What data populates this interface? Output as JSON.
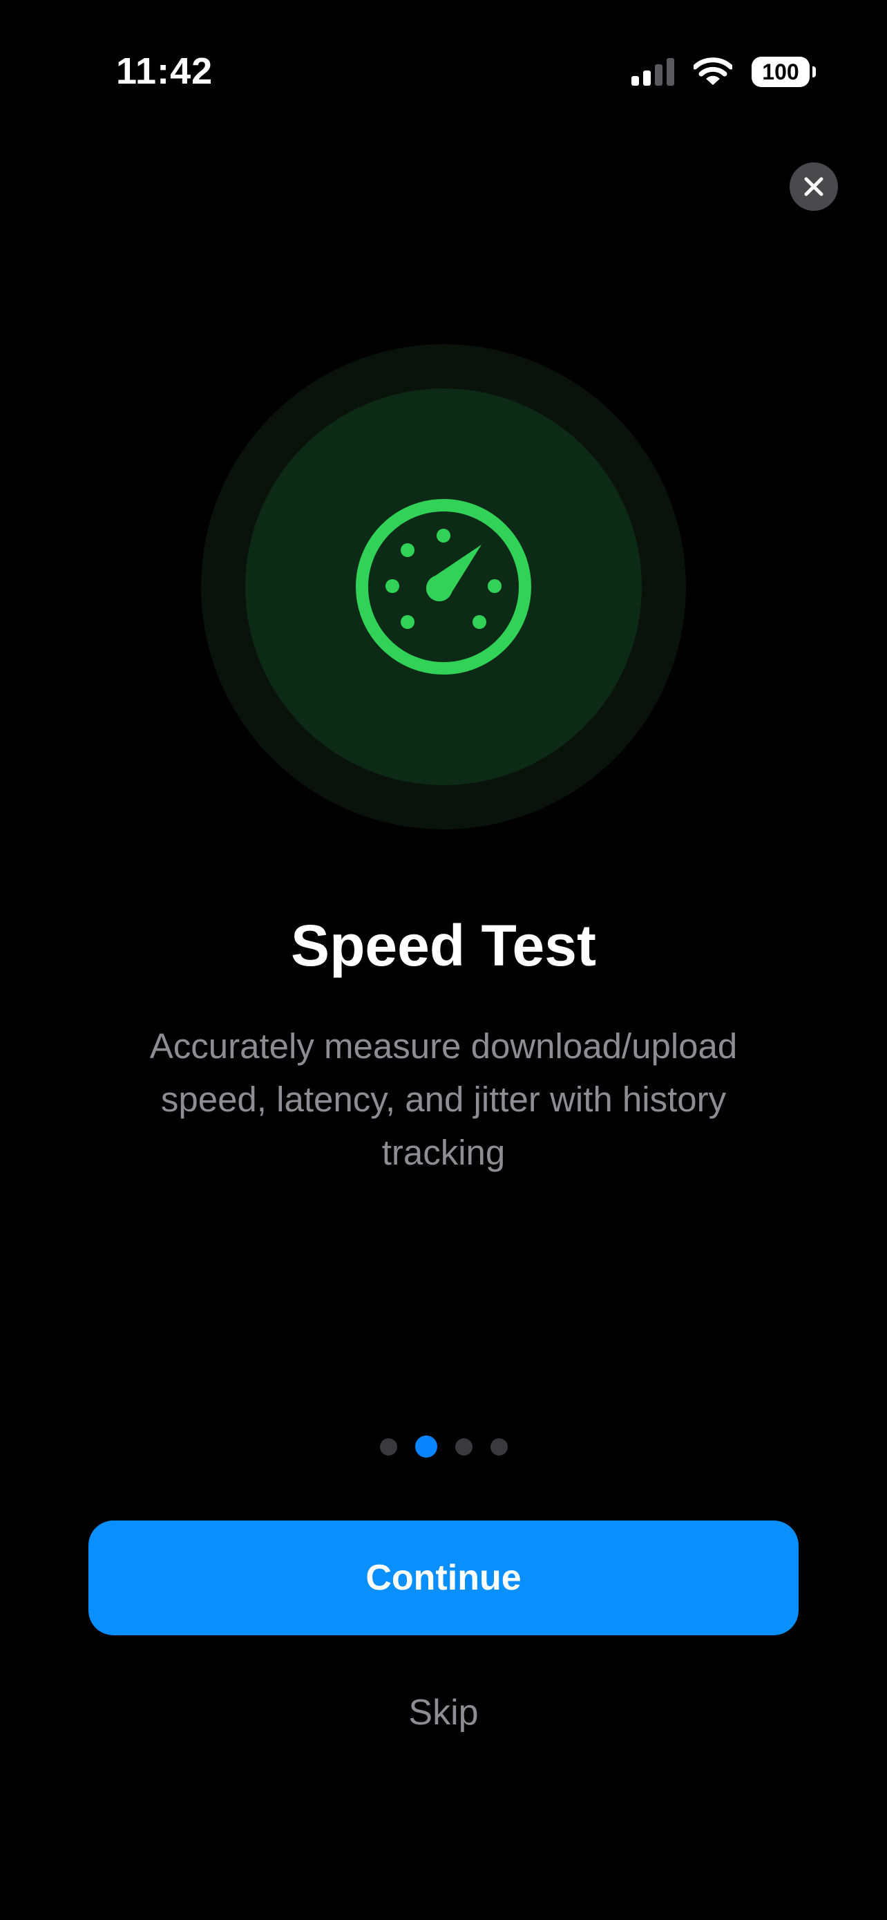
{
  "status_bar": {
    "time": "11:42",
    "battery_level": "100",
    "signal_icon": "cellular-signal-icon",
    "wifi_icon": "wifi-icon"
  },
  "close_icon": "close-icon",
  "hero_icon": "speedometer-icon",
  "colors": {
    "accent_green": "#32d158",
    "accent_blue": "#0a8ffe",
    "background": "#000000",
    "muted_text": "#8d8d93"
  },
  "onboarding": {
    "title": "Speed Test",
    "description": "Accurately measure download/upload speed, latency, and jitter with history tracking",
    "page_count": 4,
    "current_page": 2
  },
  "actions": {
    "continue_label": "Continue",
    "skip_label": "Skip"
  }
}
